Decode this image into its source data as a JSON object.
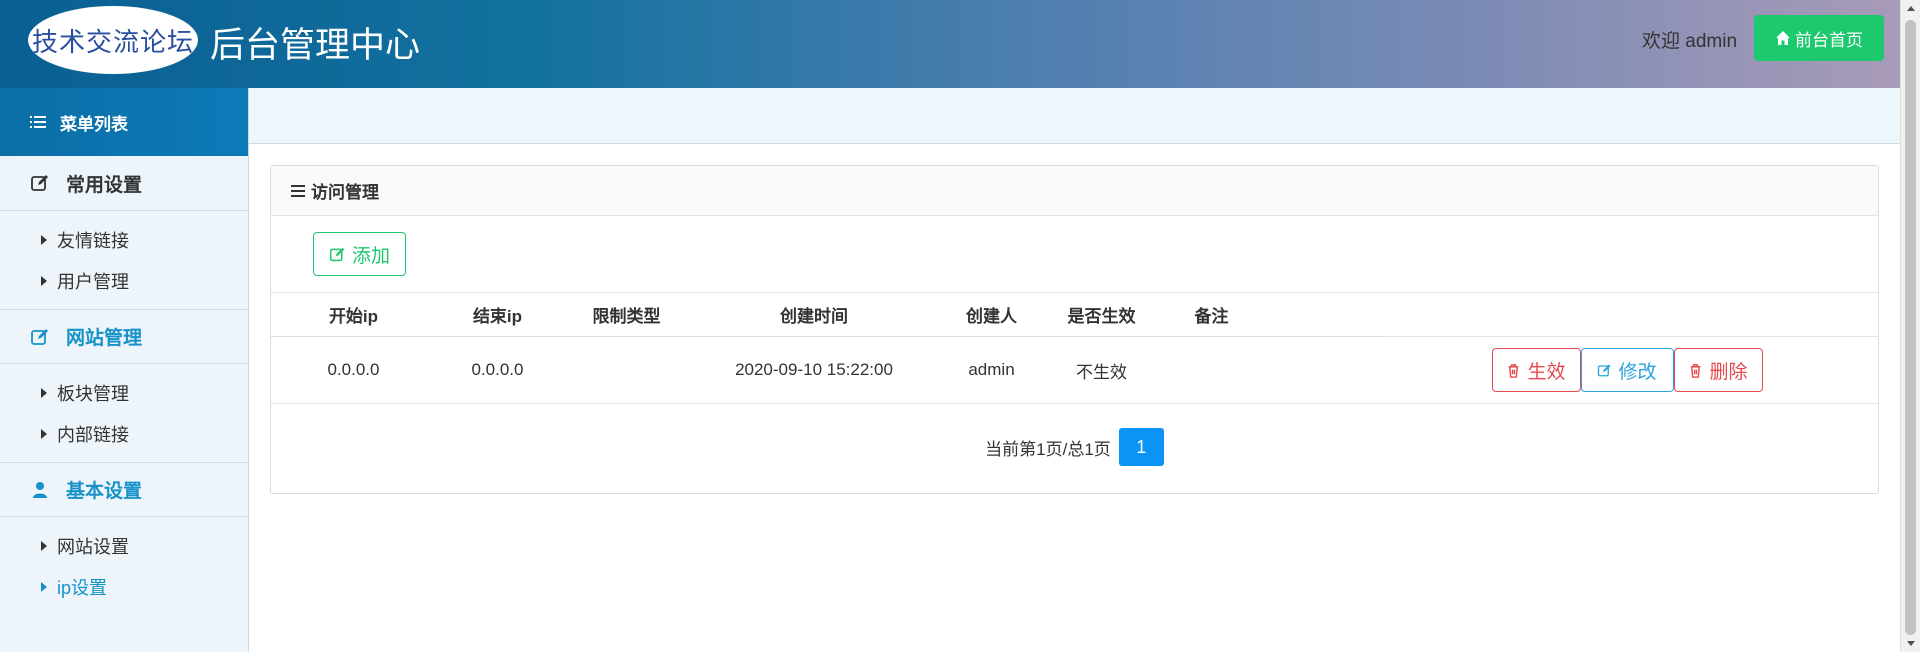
{
  "header": {
    "logo_text": "技术交流论坛",
    "title": "后台管理中心",
    "welcome": "欢迎 admin",
    "home_button": "前台首页"
  },
  "sidebar": {
    "menu_title": "菜单列表",
    "groups": [
      {
        "title": "常用设置",
        "icon": "edit-icon",
        "items": [
          "友情链接",
          "用户管理"
        ]
      },
      {
        "title": "网站管理",
        "icon": "edit-icon",
        "items": [
          "板块管理",
          "内部链接"
        ]
      },
      {
        "title": "基本设置",
        "icon": "user-icon",
        "items": [
          "网站设置",
          "ip设置"
        ]
      }
    ],
    "active_item": "ip设置"
  },
  "panel": {
    "title": "访问管理",
    "add_button": "添加",
    "columns": [
      "开始ip",
      "结束ip",
      "限制类型",
      "创建时间",
      "创建人",
      "是否生效",
      "备注"
    ],
    "rows": [
      {
        "start_ip": "0.0.0.0",
        "end_ip": "0.0.0.0",
        "limit_type": "",
        "created_at": "2020-09-10 15:22:00",
        "creator": "admin",
        "effective": "不生效",
        "remark": ""
      }
    ],
    "row_actions": {
      "activate": "生效",
      "edit": "修改",
      "delete": "删除"
    },
    "pagination": {
      "info": "当前第1页/总1页",
      "current_page": "1"
    }
  },
  "colors": {
    "accent_green": "#1dc86f",
    "accent_blue": "#1692c8",
    "danger_red": "#e5494f",
    "page_blue": "#0b93f6"
  }
}
